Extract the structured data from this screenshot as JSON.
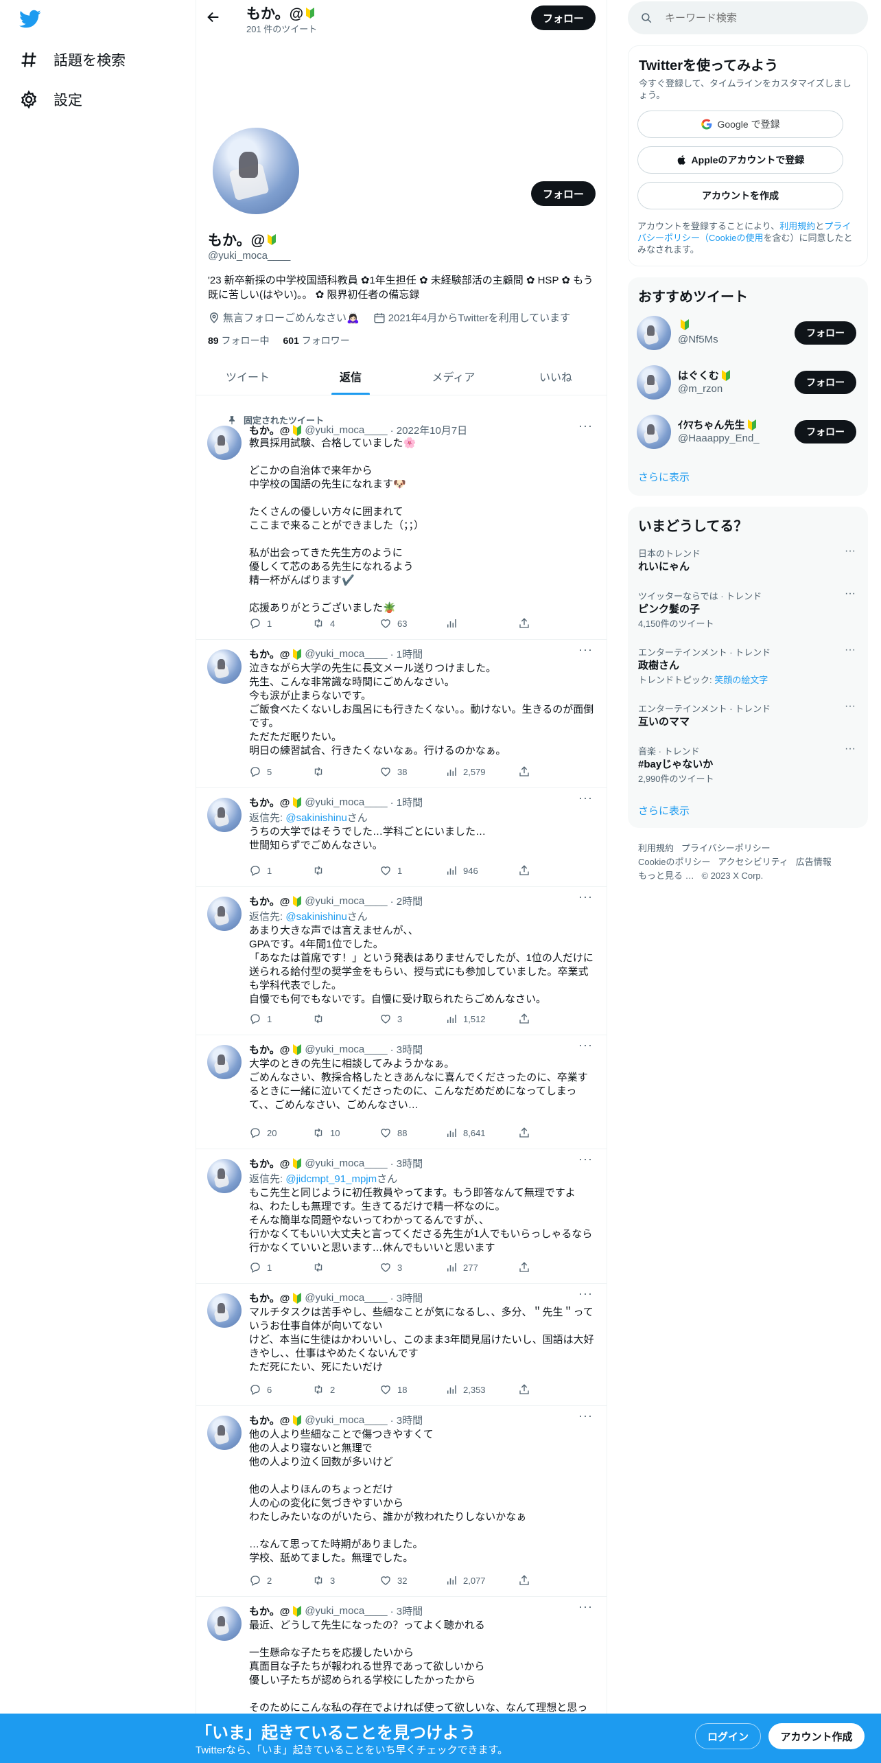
{
  "nav": {
    "explore_label": "話題を検索",
    "settings_label": "設定"
  },
  "profile": {
    "name": "もか。@",
    "tweet_count": "201 件のツイート",
    "follow_label": "フォロー",
    "handle": "@yuki_moca____",
    "bio": "'23 新卒新採の中学校国語科教員 ✿1年生担任 ✿ 未経験部活の主顧問 ✿ HSP ✿ もう既に苦しい(はやい)。。 ✿ 限界初任者の備忘録",
    "location": "無言フォローごめんなさい🙇🏻‍♀️",
    "joined": "2021年4月からTwitterを利用しています",
    "following_count": "89",
    "following_label": "フォロー中",
    "followers_count": "601",
    "followers_label": "フォロワー"
  },
  "tabs": [
    "ツイート",
    "返信",
    "メディア",
    "いいね"
  ],
  "pinned_label": "固定されたツイート",
  "tweets": [
    {
      "name": "もか。@",
      "handle": "@yuki_moca____",
      "time": "· 2022年10月7日",
      "reply_to": "",
      "text": "教員採用試験、合格していました🌸\n\nどこかの自治体で来年から\n中学校の国語の先生になれます🐶\n\nたくさんの優しい方々に囲まれて\nここまで来ることができました（；；）\n\n私が出会ってきた先生方のように\n優しくて芯のある先生になれるよう\n精一杯がんばります✔️\n\n応援ありがとうございました🪴",
      "replies": "1",
      "retweets": "4",
      "likes": "63",
      "views": ""
    },
    {
      "name": "もか。@",
      "handle": "@yuki_moca____",
      "time": "· 1時間",
      "reply_to": "",
      "text": "泣きながら大学の先生に長文メール送りつけました。\n先生、こんな非常識な時間にごめんなさい。\n今も涙が止まらないです。\nご飯食べたくないしお風呂にも行きたくない。。動けない。生きるのが面倒です。\nただただ眠りたい。\n明日の練習試合、行きたくないなぁ。行けるのかなぁ。",
      "replies": "5",
      "retweets": "",
      "likes": "38",
      "views": "2,579"
    },
    {
      "name": "もか。@",
      "handle": "@yuki_moca____",
      "time": "· 1時間",
      "reply_to": "@sakinishinu",
      "text": "うちの大学ではそうでした…学科ごとにいました…\n世間知らずでごめんなさい。",
      "replies": "1",
      "retweets": "",
      "likes": "1",
      "views": "946"
    },
    {
      "name": "もか。@",
      "handle": "@yuki_moca____",
      "time": "· 2時間",
      "reply_to": "@sakinishinu",
      "text": "あまり大きな声では言えませんが、、\nGPAです。4年間1位でした。\n「あなたは首席です！」という発表はありませんでしたが、1位の人だけに送られる給付型の奨学金をもらい、授与式にも参加していました。卒業式も学科代表でした。\n自慢でも何でもないです。自慢に受け取られたらごめんなさい。",
      "replies": "1",
      "retweets": "",
      "likes": "3",
      "views": "1,512"
    },
    {
      "name": "もか。@",
      "handle": "@yuki_moca____",
      "time": "· 3時間",
      "reply_to": "",
      "text": "大学のときの先生に相談してみようかなぁ。\nごめんなさい、教採合格したときあんなに喜んでくださったのに、卒業するときに一緒に泣いてくださったのに、こんなだめだめになってしまって、、ごめんなさい、ごめんなさい…",
      "replies": "20",
      "retweets": "10",
      "likes": "88",
      "views": "8,641"
    },
    {
      "name": "もか。@",
      "handle": "@yuki_moca____",
      "time": "· 3時間",
      "reply_to": "@jidcmpt_91_mpjm",
      "text": "もこ先生と同じように初任教員やってます。もう即答なんて無理ですよね、わたしも無理です。生きてるだけで精一杯なのに。\nそんな簡単な問題やないってわかってるんですが、、\n行かなくてもいい大丈夫と言ってくださる先生が1人でもいらっしゃるなら行かなくていいと思います…休んでもいいと思います",
      "replies": "1",
      "retweets": "",
      "likes": "3",
      "views": "277"
    },
    {
      "name": "もか。@",
      "handle": "@yuki_moca____",
      "time": "· 3時間",
      "reply_to": "",
      "text": "マルチタスクは苦手やし、些細なことが気になるし、、多分、＂先生＂っていうお仕事自体が向いてない\nけど、本当に生徒はかわいいし、このまま3年間見届けたいし、国語は大好きやし、、仕事はやめたくないんです\nただ死にたい、死にたいだけ",
      "replies": "6",
      "retweets": "2",
      "likes": "18",
      "views": "2,353"
    },
    {
      "name": "もか。@",
      "handle": "@yuki_moca____",
      "time": "· 3時間",
      "reply_to": "",
      "text": "他の人より些細なことで傷つきやすくて\n他の人より寝ないと無理で\n他の人より泣く回数が多いけど\n\n他の人よりほんのちょっとだけ\n人の心の変化に気づきやすいから\nわたしみたいなのがいたら、誰かが救われたりしないかなぁ\n\n…なんて思ってた時期がありました。\n学校、舐めてました。無理でした。",
      "replies": "2",
      "retweets": "3",
      "likes": "32",
      "views": "2,077"
    },
    {
      "name": "もか。@",
      "handle": "@yuki_moca____",
      "time": "· 3時間",
      "reply_to": "",
      "text": "最近、どうして先生になったの？ってよく聴かれる\n\n一生懸命な子たちを応援したいから\n真面目な子たちが報われる世界であって欲しいから\n優しい子たちが認められる学校にしたかったから\n\nそのためにこんな私の存在でよければ使って欲しいな、なんて理想と思っ",
      "replies": "",
      "retweets": "",
      "likes": "",
      "views": ""
    }
  ],
  "reply_prefix": "返信先: ",
  "reply_suffix": "さん",
  "search": {
    "placeholder": "キーワード検索"
  },
  "signup": {
    "title": "Twitterを使ってみよう",
    "subtitle": "今すぐ登録して、タイムラインをカスタマイズしましょう。",
    "google_label": "Google で登録",
    "apple_label": "Appleのアカウントで登録",
    "create_label": "アカウントを作成",
    "terms_1": "アカウントを登録することにより、",
    "terms_link1": "利用規約",
    "terms_2": "と",
    "terms_link2": "プライバシーポリシー（Cookieの使用",
    "terms_3": "を含む）に同意したとみなされます。"
  },
  "recommend": {
    "title": "おすすめツイート",
    "users": [
      {
        "name": "",
        "handle": "@Nf5Ms",
        "follow": "フォロー"
      },
      {
        "name": "はぐくむ",
        "handle": "@m_rzon",
        "follow": "フォロー"
      },
      {
        "name": "ｲｸﾏちゃん先生",
        "handle": "@Haaappy_End_",
        "follow": "フォロー"
      }
    ],
    "more": "さらに表示"
  },
  "trends": {
    "title": "いまどうしてる？",
    "items": [
      {
        "meta": "日本のトレンド",
        "name": "れいにゃん",
        "count": ""
      },
      {
        "meta": "ツイッターならでは · トレンド",
        "name": "ピンク髪の子",
        "count": "4,150件のツイート"
      },
      {
        "meta": "エンターテインメント · トレンド",
        "name": "政樹さん",
        "count": "トレンドトピック: ",
        "count_link": "笑顔の絵文字"
      },
      {
        "meta": "エンターテインメント · トレンド",
        "name": "互いのママ",
        "count": ""
      },
      {
        "meta": "音楽 · トレンド",
        "name": "#bayじゃないか",
        "count": "2,990件のツイート"
      }
    ],
    "more": "さらに表示"
  },
  "footer": {
    "links": [
      "利用規約",
      "プライバシーポリシー",
      "Cookieのポリシー",
      "アクセシビリティ",
      "広告情報",
      "もっと見る …"
    ],
    "copyright": "© 2023 X Corp."
  },
  "bottom": {
    "title": "「いま」起きていることを見つけよう",
    "subtitle": "Twitterなら、「いま」起きていることをいち早くチェックできます。",
    "login": "ログイン",
    "signup": "アカウント作成"
  },
  "colors": {
    "accent": "#1d9bf0",
    "dark": "#0f1419",
    "muted": "#536471"
  }
}
